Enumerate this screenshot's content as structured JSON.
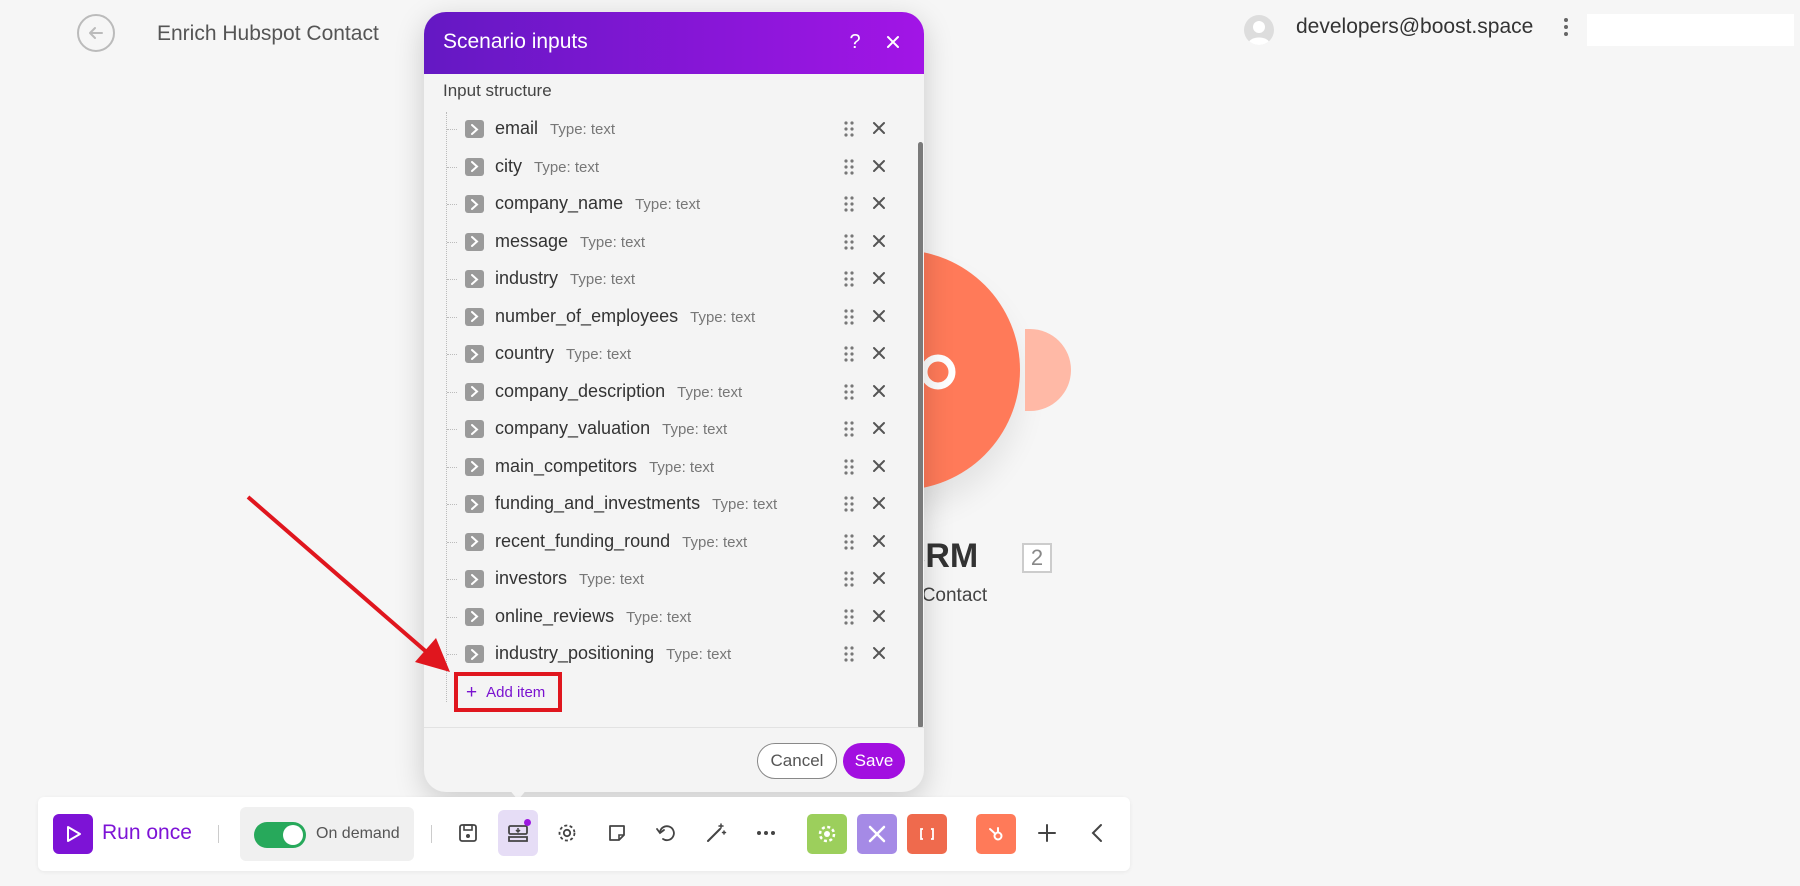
{
  "header": {
    "scenario_title": "Enrich Hubspot Contact",
    "user_email": "developers@boost.space"
  },
  "canvas_module": {
    "title": ": CRM",
    "count": "2",
    "subtitle": "e a Contact",
    "color": "#ff7a59"
  },
  "modal": {
    "title": "Scenario inputs",
    "help_label": "?",
    "section_label": "Input structure",
    "fields": [
      {
        "name": "email",
        "type": "Type: text"
      },
      {
        "name": "city",
        "type": "Type: text"
      },
      {
        "name": "company_name",
        "type": "Type: text"
      },
      {
        "name": "message",
        "type": "Type: text"
      },
      {
        "name": "industry",
        "type": "Type: text"
      },
      {
        "name": "number_of_employees",
        "type": "Type: text"
      },
      {
        "name": "country",
        "type": "Type: text"
      },
      {
        "name": "company_description",
        "type": "Type: text"
      },
      {
        "name": "company_valuation",
        "type": "Type: text"
      },
      {
        "name": "main_competitors",
        "type": "Type: text"
      },
      {
        "name": "funding_and_investments",
        "type": "Type: text"
      },
      {
        "name": "recent_funding_round",
        "type": "Type: text"
      },
      {
        "name": "investors",
        "type": "Type: text"
      },
      {
        "name": "online_reviews",
        "type": "Type: text"
      },
      {
        "name": "industry_positioning",
        "type": "Type: text"
      }
    ],
    "add_item_label": "Add item",
    "cancel_label": "Cancel",
    "save_label": "Save",
    "header_gradient": [
      "#6418c3",
      "#a215e6"
    ]
  },
  "toolbar": {
    "run_label": "Run once",
    "schedule_label": "On demand",
    "schedule_enabled": true,
    "accent": "#7d13d6",
    "apps": [
      {
        "icon": "gear-app-icon",
        "color": "#9ccf5c"
      },
      {
        "icon": "tools-app-icon",
        "color": "#a58ae6"
      },
      {
        "icon": "brackets-app-icon",
        "color": "#ef6a4d"
      },
      {
        "icon": "hubspot-app-icon",
        "color": "#ff7a59"
      }
    ]
  }
}
